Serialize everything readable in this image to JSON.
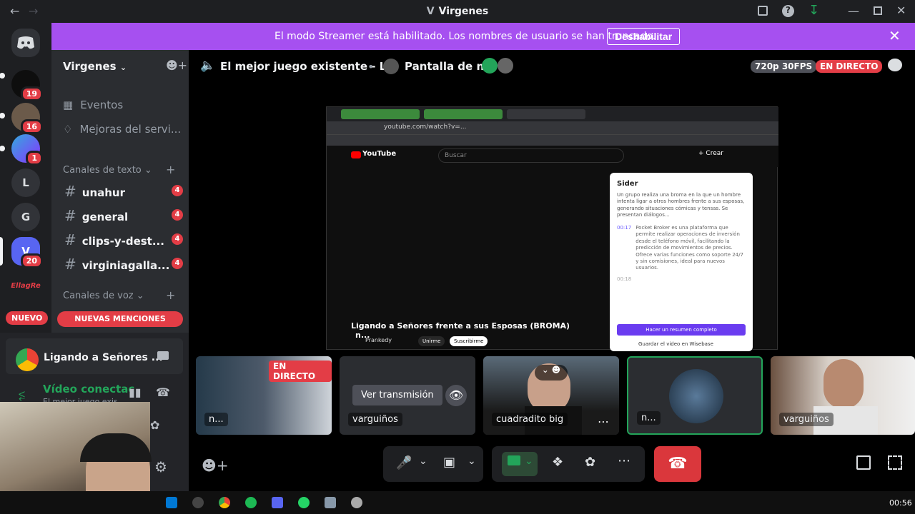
{
  "window": {
    "title": "Virgenes",
    "title_icon": "V"
  },
  "banner": {
    "message": "El modo Streamer está habilitado. Los nombres de usuario se han truncado.",
    "button": "Deshabilitar"
  },
  "rail": {
    "servers": [
      {
        "label": "",
        "badge": "19"
      },
      {
        "label": "",
        "badge": "16"
      },
      {
        "label": "",
        "badge": "1"
      },
      {
        "label": "L",
        "badge": ""
      },
      {
        "label": "G",
        "badge": ""
      },
      {
        "label": "V",
        "badge": "20"
      },
      {
        "label": "",
        "badge": ""
      }
    ],
    "nuevo": "NUEVO"
  },
  "sidebar": {
    "server_name": "Virgenes",
    "events": "Eventos",
    "boosts": "Mejoras del servi...",
    "text_category": "Canales de texto",
    "voice_category": "Canales de voz",
    "channels": [
      {
        "name": "unahur",
        "badge": "4"
      },
      {
        "name": "general",
        "badge": "4"
      },
      {
        "name": "clips-y-dest...",
        "badge": "4"
      },
      {
        "name": "virginiagalla...",
        "badge": "4"
      }
    ],
    "mentions": "NUEVAS MENCIONES"
  },
  "panel": {
    "activity": "Ligando a Señores ...",
    "voice_status": "Vídeo conectac",
    "voice_sub": "El mejor juego exis..."
  },
  "header": {
    "channel": "El mejor juego existente - Lol",
    "stream": "Pantalla de n...",
    "quality": "720p 30FPS",
    "live": "EN DIRECTO"
  },
  "stream": {
    "url": "youtube.com/watch?v=...",
    "search_placeholder": "Buscar",
    "create": "Crear",
    "video_title": "Ligando a Señores frente a sus Esposas (BROMA)",
    "channel": "Prankedy",
    "join": "Unirme",
    "subscribe": "Suscribirme",
    "sider": {
      "title": "Sider",
      "summary": "Un grupo realiza una broma en la que un hombre intenta ligar a otros hombres frente a sus esposas, generando situaciones cómicas y tensas. Se presentan diálogos...",
      "time": "00:17",
      "time_text": "Pocket Broker es una plataforma que permite realizar operaciones de inversión desde el teléfono móvil, facilitando la predicción de movimientos de precios. Ofrece varias funciones como soporte 24/7 y sin comisiones, ideal para nuevos usuarios.",
      "time2": "00:18",
      "button": "Hacer un resumen completo",
      "save": "Guardar el video en Wisebase"
    },
    "overlay_name": "n..."
  },
  "tiles": [
    {
      "label": "n...",
      "live": "EN DIRECTO"
    },
    {
      "label": "varguiños",
      "button": "Ver transmisión"
    },
    {
      "label": "cuadradito big"
    },
    {
      "label": "n..."
    },
    {
      "label": "varguiños"
    }
  ],
  "taskbar": {
    "time": "00:56"
  }
}
